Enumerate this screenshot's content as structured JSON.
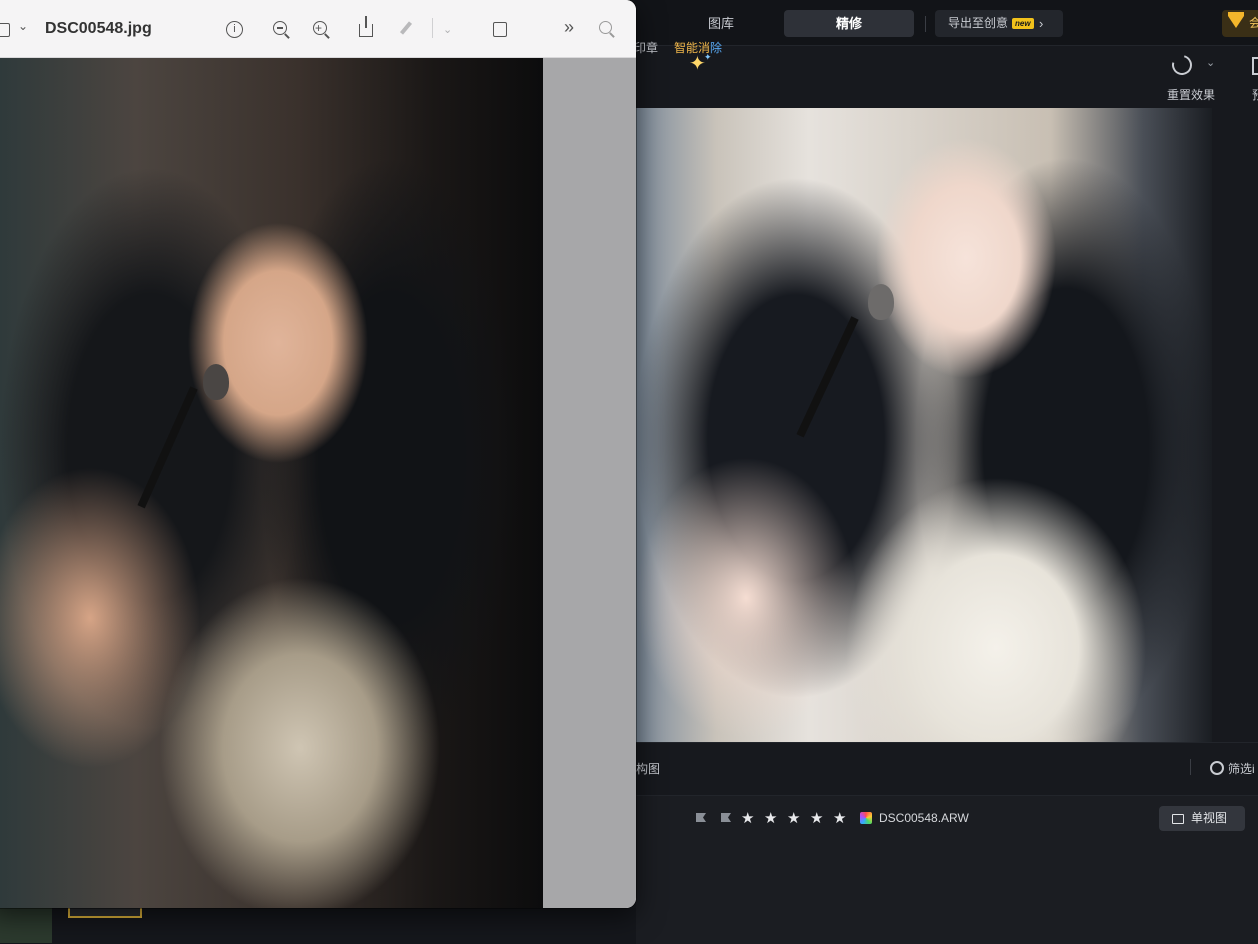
{
  "editor": {
    "tabs": [
      {
        "label": "图库"
      },
      {
        "label": "精修"
      }
    ],
    "export": {
      "label": "导出至创意",
      "badge": "new"
    },
    "vip": {
      "label": "会"
    },
    "toolbar": {
      "partial_label": "印章",
      "smart_erase": {
        "part1": "智能消",
        "part2": "除"
      },
      "reset_label": "重置效果",
      "preview_label": "预"
    },
    "filmstrip": {
      "label": "构图",
      "filter_label": "筛选i"
    },
    "info": {
      "rating_stars": 5,
      "stars": [
        "★",
        "★",
        "★",
        "★",
        "★"
      ],
      "file_name": "DSC00548.ARW",
      "single_view_label": "单视图"
    }
  },
  "preview_window": {
    "title": "DSC00548.jpg",
    "info_glyph": "i",
    "more_glyph": "»",
    "chevron_glyph": "⌄"
  },
  "colors": {
    "accent_gold": "#f2c21b",
    "selected_thumb": "#e3b73c",
    "smart_erase_orange": "#f2b84b",
    "smart_erase_blue": "#57a7f0"
  }
}
